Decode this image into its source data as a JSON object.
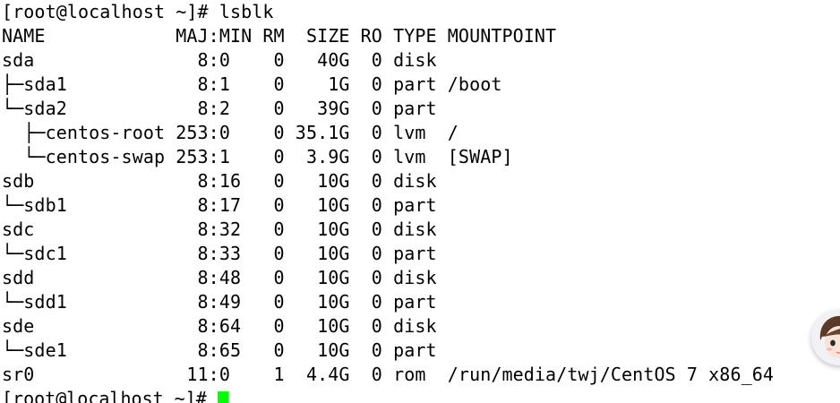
{
  "terminal": {
    "command_prompt": "[root@localhost ~]# ",
    "command": "lsblk",
    "header": "NAME            MAJ:MIN RM  SIZE RO TYPE MOUNTPOINT",
    "rows": [
      "sda               8:0    0   40G  0 disk ",
      "├─sda1            8:1    0    1G  0 part /boot",
      "└─sda2            8:2    0   39G  0 part ",
      "  ├─centos-root 253:0    0 35.1G  0 lvm  /",
      "  └─centos-swap 253:1    0  3.9G  0 lvm  [SWAP]",
      "sdb               8:16   0   10G  0 disk ",
      "└─sdb1            8:17   0   10G  0 part ",
      "sdc               8:32   0   10G  0 disk ",
      "└─sdc1            8:33   0   10G  0 part ",
      "sdd               8:48   0   10G  0 disk ",
      "└─sdd1            8:49   0   10G  0 part ",
      "sde               8:64   0   10G  0 disk ",
      "└─sde1            8:65   0   10G  0 part ",
      "sr0              11:0    1  4.4G  0 rom  /run/media/twj/CentOS 7 x86_64"
    ],
    "final_prompt": "[root@localhost ~]# ",
    "cursor_color": "#00ff00"
  }
}
